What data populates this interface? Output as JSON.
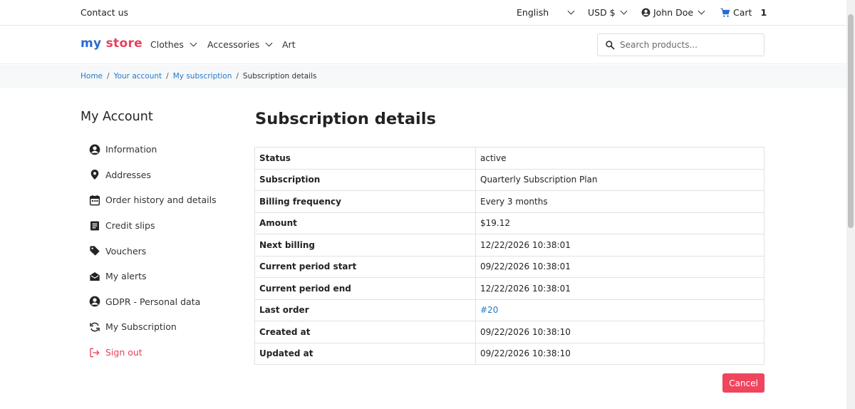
{
  "topbar": {
    "contact": "Contact us",
    "language": "English",
    "currency": "USD $",
    "user": "John Doe",
    "cart_label": "Cart",
    "cart_count": "1"
  },
  "header": {
    "logo_my": "my",
    "logo_store": "store",
    "nav": [
      "Clothes",
      "Accessories",
      "Art"
    ],
    "search_placeholder": "Search products..."
  },
  "breadcrumb": {
    "home": "Home",
    "account": "Your account",
    "subscription": "My subscription",
    "current": "Subscription details"
  },
  "sidebar": {
    "title": "My Account",
    "items": [
      {
        "label": "Information",
        "icon": "account-circle-icon"
      },
      {
        "label": "Addresses",
        "icon": "location-pin-icon"
      },
      {
        "label": "Order history and details",
        "icon": "calendar-icon"
      },
      {
        "label": "Credit slips",
        "icon": "receipt-icon"
      },
      {
        "label": "Vouchers",
        "icon": "tag-icon"
      },
      {
        "label": "My alerts",
        "icon": "mail-open-icon"
      },
      {
        "label": "GDPR - Personal data",
        "icon": "account-circle-icon"
      },
      {
        "label": "My Subscription",
        "icon": "refresh-icon"
      },
      {
        "label": "Sign out",
        "icon": "logout-icon"
      }
    ]
  },
  "main": {
    "title": "Subscription details",
    "rows": [
      {
        "key": "Status",
        "value": "active"
      },
      {
        "key": "Subscription",
        "value": "Quarterly Subscription Plan"
      },
      {
        "key": "Billing frequency",
        "value": "Every 3 months"
      },
      {
        "key": "Amount",
        "value": "$19.12"
      },
      {
        "key": "Next billing",
        "value": "12/22/2026 10:38:01"
      },
      {
        "key": "Current period start",
        "value": "09/22/2026 10:38:01"
      },
      {
        "key": "Current period end",
        "value": "12/22/2026 10:38:01"
      },
      {
        "key": "Last order",
        "value": "#20"
      },
      {
        "key": "Created at",
        "value": "09/22/2026 10:38:10"
      },
      {
        "key": "Updated at",
        "value": "09/22/2026 10:38:10"
      }
    ],
    "cancel_label": "Cancel"
  },
  "colors": {
    "accent_blue": "#2a7ac8",
    "danger": "#f0455e",
    "logo_blue": "#2a6bd1",
    "logo_red": "#e8415a"
  }
}
